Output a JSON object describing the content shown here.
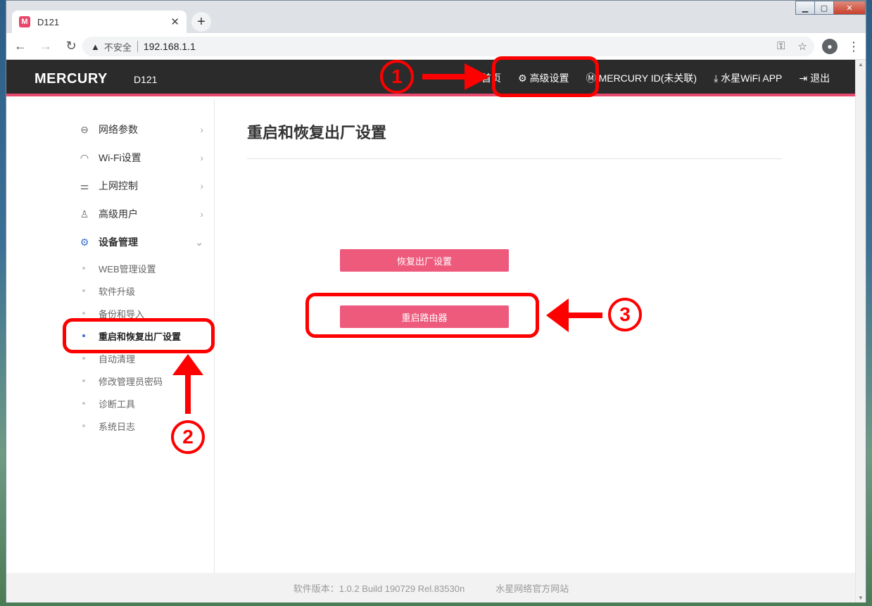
{
  "browser": {
    "tab_title": "D121",
    "tab_favicon": "M",
    "security_label": "不安全",
    "url": "192.168.1.1"
  },
  "header": {
    "logo": "MERCURY",
    "model": "D121",
    "nav": [
      {
        "label": "首页",
        "icon": "home-icon"
      },
      {
        "label": "高级设置",
        "icon": "gear-icon"
      },
      {
        "label": "MERCURY ID(未关联)",
        "icon": "mercury-id-icon"
      },
      {
        "label": "水星WiFi APP",
        "icon": "download-icon"
      },
      {
        "label": "退出",
        "icon": "logout-icon"
      }
    ]
  },
  "sidebar": {
    "menu": [
      {
        "label": "网络参数",
        "icon": "network-icon"
      },
      {
        "label": "Wi-Fi设置",
        "icon": "wifi-icon"
      },
      {
        "label": "上网控制",
        "icon": "control-icon"
      },
      {
        "label": "高级用户",
        "icon": "user-icon"
      },
      {
        "label": "设备管理",
        "icon": "device-gear-icon"
      }
    ],
    "submenu": [
      {
        "label": "WEB管理设置"
      },
      {
        "label": "软件升级"
      },
      {
        "label": "备份和导入"
      },
      {
        "label": "重启和恢复出厂设置"
      },
      {
        "label": "自动清理"
      },
      {
        "label": "修改管理员密码"
      },
      {
        "label": "诊断工具"
      },
      {
        "label": "系统日志"
      }
    ]
  },
  "main": {
    "title": "重启和恢复出厂设置",
    "factory_reset_label": "恢复出厂设置",
    "reboot_label": "重启路由器"
  },
  "footer": {
    "version": "软件版本：1.0.2 Build 190729 Rel.83530n",
    "site_link": "水星网络官方网站"
  },
  "annotations": {
    "step1": "1",
    "step2": "2",
    "step3": "3"
  },
  "colors": {
    "accent": "#e84a6f",
    "button": "#ee5a7c",
    "header_bg": "#2b2b2b",
    "annotation": "#ff0000",
    "active_blue": "#3b6fd1"
  }
}
